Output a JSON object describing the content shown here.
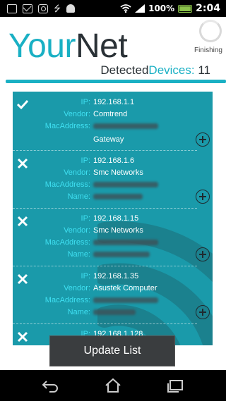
{
  "status_bar": {
    "battery_percent": "100%",
    "time": "2:04",
    "icons": [
      "image-icon",
      "mail-icon",
      "camera-icon",
      "usb-icon",
      "android-icon",
      "wifi-icon",
      "signal-icon",
      "battery-icon"
    ]
  },
  "header": {
    "logo_part1": "Your",
    "logo_part2": "Net",
    "scan_status": "Finishing",
    "detected_label_1": "Detected",
    "detected_label_2": "Devices:",
    "device_count": "11"
  },
  "labels": {
    "ip": "IP:",
    "vendor": "Vendor:",
    "mac": "MacAddress:",
    "name": "Name:"
  },
  "devices": [
    {
      "status": "check",
      "ip": "192.168.1.1",
      "vendor": "Comtrend",
      "name": "Gateway"
    },
    {
      "status": "cross",
      "ip": "192.168.1.6",
      "vendor": "Smc Networks",
      "name": ""
    },
    {
      "status": "cross",
      "ip": "192.168.1.15",
      "vendor": "Smc Networks",
      "name": ""
    },
    {
      "status": "cross",
      "ip": "192.168.1.35",
      "vendor": "Asustek Computer",
      "name": ""
    },
    {
      "status": "cross",
      "ip": "192.168.1.128",
      "vendor": "",
      "name": ""
    }
  ],
  "update_button": "Update List",
  "colors": {
    "accent": "#1ab0c4",
    "panel": "#1a9aaa",
    "label": "#3fe0f2"
  }
}
